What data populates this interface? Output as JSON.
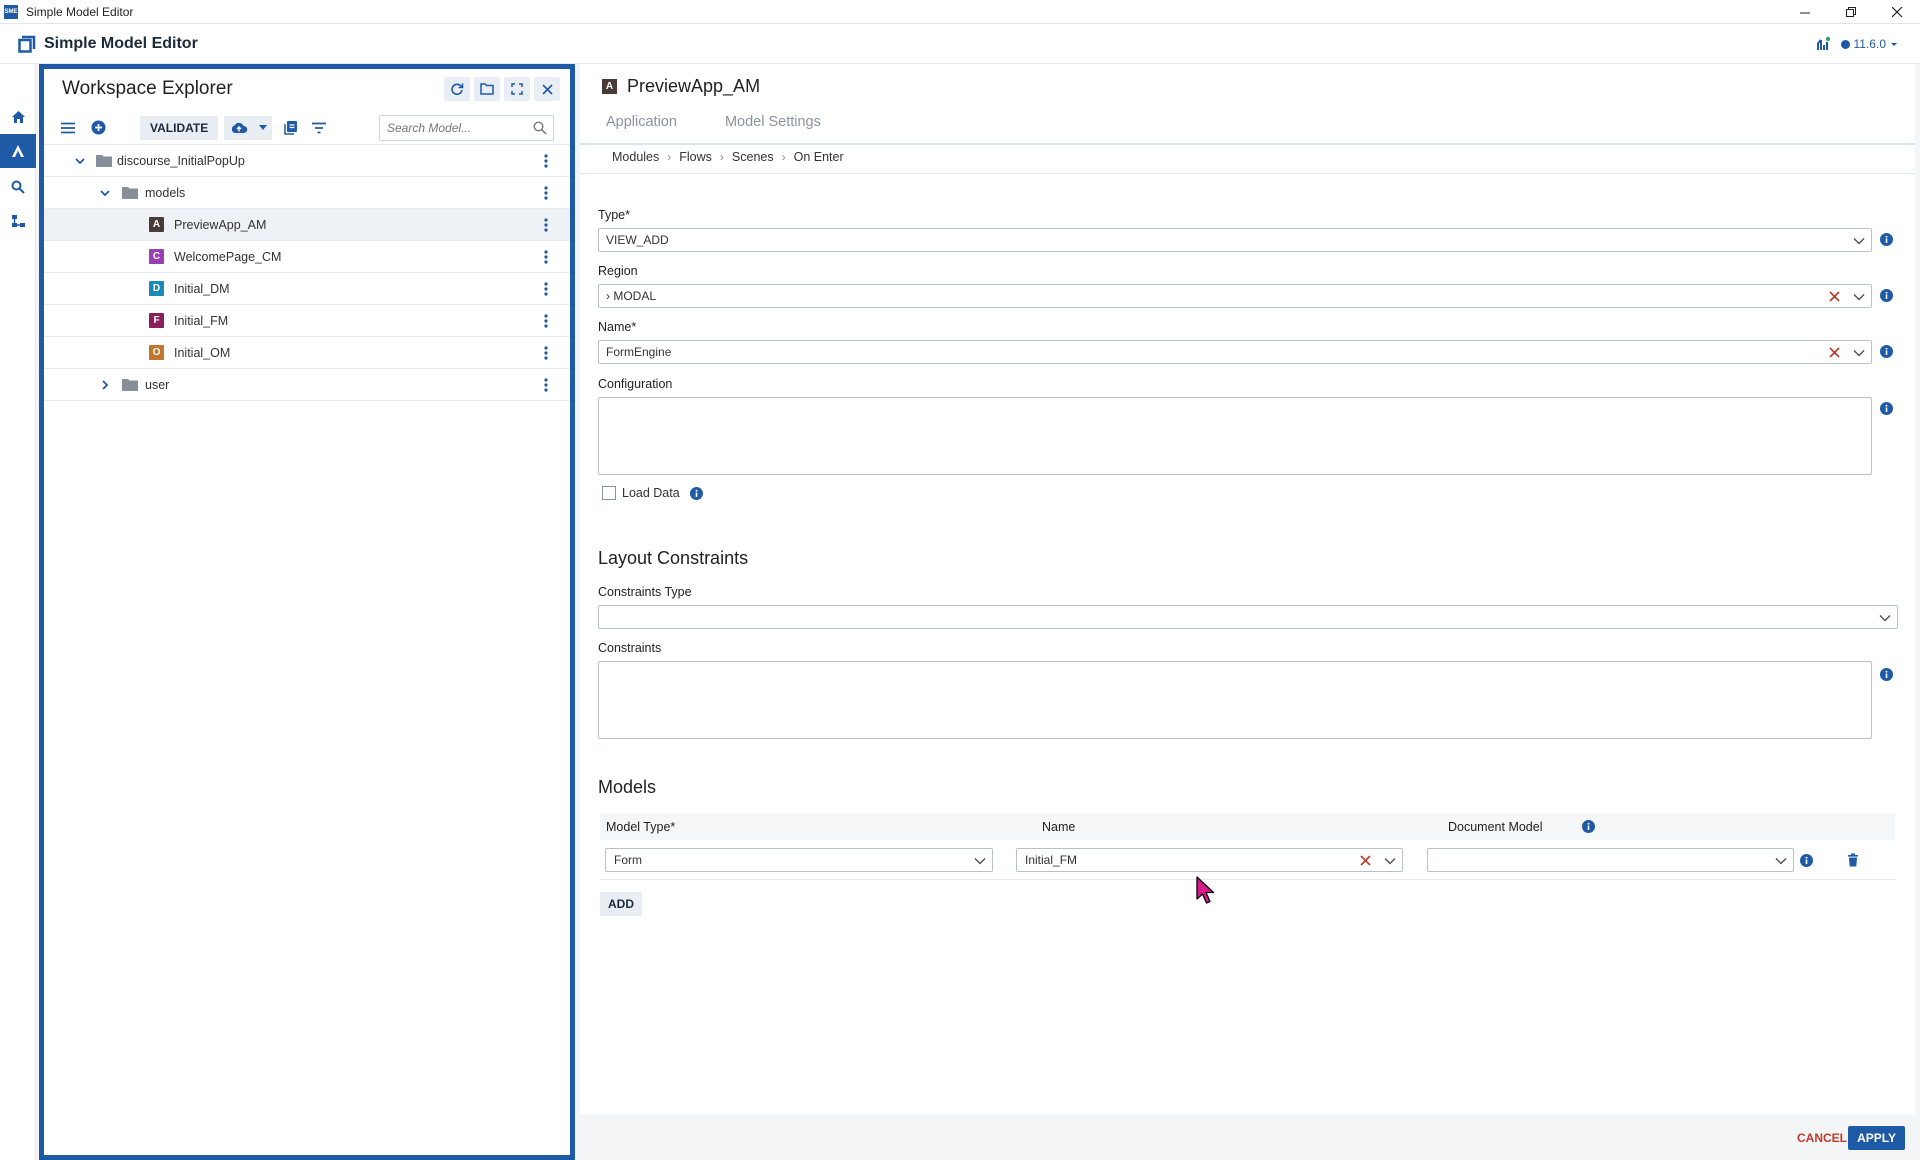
{
  "window": {
    "title": "Simple Model Editor",
    "icon_text": "SME"
  },
  "app": {
    "title": "Simple Model Editor",
    "version": "11.6.0"
  },
  "explorer": {
    "title": "Workspace Explorer",
    "validate_label": "VALIDATE",
    "search_placeholder": "Search Model...",
    "tree": {
      "root": "discourse_InitialPopUp",
      "models_folder": "models",
      "items": [
        {
          "badge": "A",
          "label": "PreviewApp_AM",
          "color": "#4a3a36"
        },
        {
          "badge": "C",
          "label": "WelcomePage_CM",
          "color": "#9b3fb5"
        },
        {
          "badge": "D",
          "label": "Initial_DM",
          "color": "#1a8bb8"
        },
        {
          "badge": "F",
          "label": "Initial_FM",
          "color": "#8a1f5c"
        },
        {
          "badge": "O",
          "label": "Initial_OM",
          "color": "#c0762e"
        }
      ],
      "user_folder": "user"
    }
  },
  "editor": {
    "model_badge": "A",
    "model_title": "PreviewApp_AM",
    "tabs": [
      "Application",
      "Model Settings"
    ],
    "breadcrumb": [
      "Modules",
      "Flows",
      "Scenes",
      "On Enter"
    ],
    "fields": {
      "type_label": "Type*",
      "type_value": "VIEW_ADD",
      "region_label": "Region",
      "region_value": "› MODAL",
      "name_label": "Name*",
      "name_value": "FormEngine",
      "config_label": "Configuration",
      "load_data_label": "Load Data"
    },
    "layout": {
      "title": "Layout Constraints",
      "constraints_type_label": "Constraints Type",
      "constraints_label": "Constraints"
    },
    "models": {
      "title": "Models",
      "col_model_type": "Model Type*",
      "col_name": "Name",
      "col_document_model": "Document Model",
      "row": {
        "model_type": "Form",
        "name": "Initial_FM",
        "document_model": ""
      },
      "add_label": "ADD"
    },
    "footer": {
      "cancel": "CANCEL",
      "apply": "APPLY"
    }
  },
  "colors": {
    "accent": "#1f5aa6",
    "danger": "#c0392b",
    "cursor": "#d81b8c"
  }
}
